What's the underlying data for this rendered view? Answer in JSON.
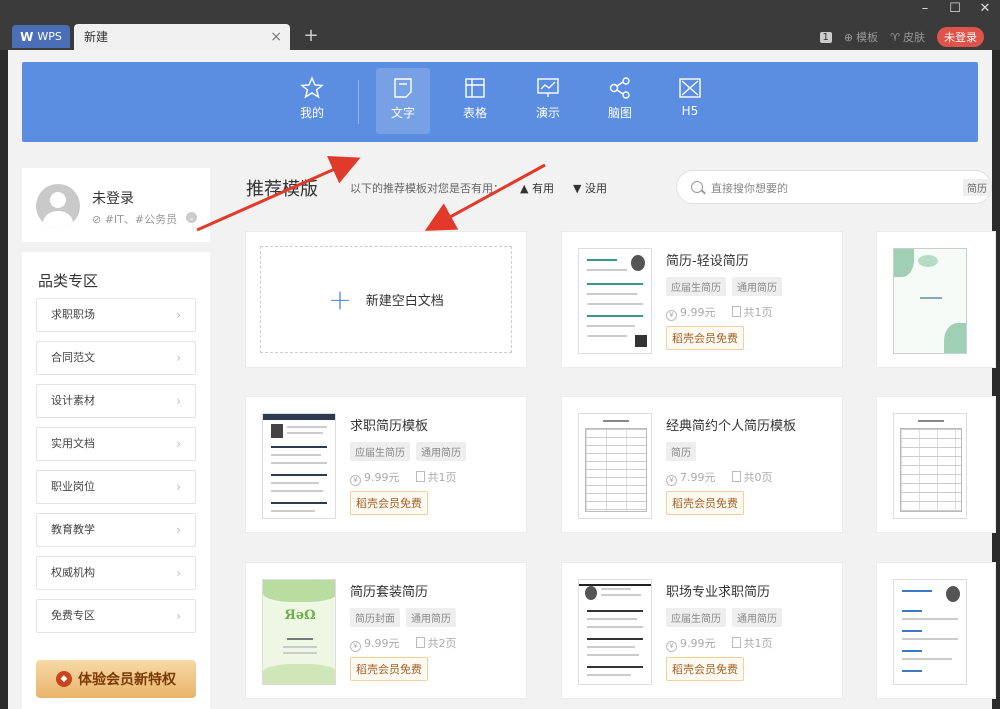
{
  "titlebar": {
    "app_tab": "WPS",
    "doc_tab": "新建",
    "count_badge": "1",
    "templates_label": "模板",
    "skins_label": "皮肤",
    "login_button": "未登录"
  },
  "nav": {
    "items": [
      {
        "label": "我的"
      },
      {
        "label": "文字"
      },
      {
        "label": "表格"
      },
      {
        "label": "演示"
      },
      {
        "label": "脑图"
      },
      {
        "label": "H5"
      }
    ],
    "active": "文字"
  },
  "profile": {
    "name": "未登录",
    "tags": "#IT、#公务员"
  },
  "category": {
    "title": "品类专区",
    "items": [
      "求职职场",
      "合同范文",
      "设计素材",
      "实用文档",
      "职业岗位",
      "教育教学",
      "权威机构",
      "免费专区"
    ],
    "vip_button": "体验会员新特权"
  },
  "recommend": {
    "title": "推荐模版",
    "question": "以下的推荐模板对您是否有用：",
    "useful": "有用",
    "useless": "没用",
    "search_placeholder": "直接搜你想要的",
    "search_tag": "简历"
  },
  "blank_card": {
    "label": "新建空白文档"
  },
  "templates": [
    {
      "title": "简历-轻设简历",
      "tags": [
        "应届生简历",
        "通用简历"
      ],
      "price": "9.99元",
      "pages": "共1页",
      "vip": "稻壳会员免费"
    },
    {
      "title": "求职简历模板",
      "tags": [
        "应届生简历",
        "通用简历"
      ],
      "price": "9.99元",
      "pages": "共1页",
      "vip": "稻壳会员免费"
    },
    {
      "title": "经典简约个人简历模板",
      "tags": [
        "简历"
      ],
      "price": "7.99元",
      "pages": "共0页",
      "vip": "稻壳会员免费"
    },
    {
      "title": "简历套装简历",
      "tags": [
        "简历封面",
        "通用简历"
      ],
      "price": "9.99元",
      "pages": "共2页",
      "vip": "稻壳会员免费"
    },
    {
      "title": "职场专业求职简历",
      "tags": [
        "应届生简历",
        "通用简历"
      ],
      "price": "9.99元",
      "pages": "共1页",
      "vip": "稻壳会员免费"
    }
  ],
  "colors": {
    "accent": "#5b8de0",
    "titlebar": "#3b3b3b",
    "login_pill": "#e0534a",
    "annotation_arrow": "#e23a2a"
  }
}
